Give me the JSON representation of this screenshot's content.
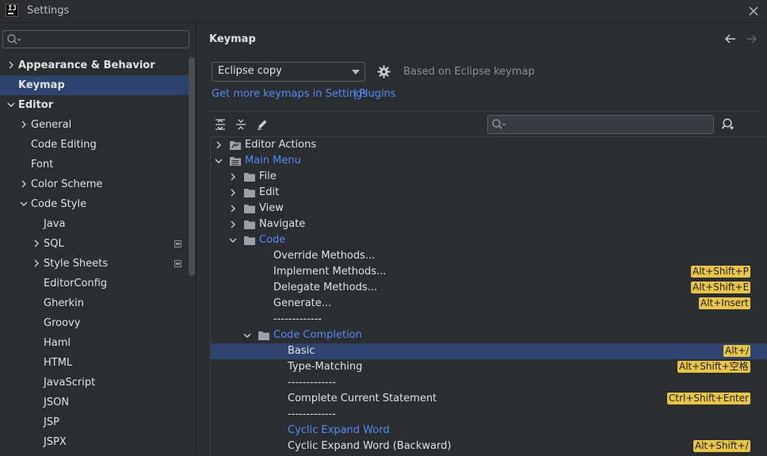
{
  "window": {
    "title": "Settings"
  },
  "sidebar": {
    "search_placeholder": "",
    "items": [
      {
        "label": "Appearance & Behavior",
        "arrow": "right",
        "bold": true
      },
      {
        "label": "Keymap",
        "arrow": "none",
        "bold": true,
        "selected": true
      },
      {
        "label": "Editor",
        "arrow": "down",
        "bold": true
      },
      {
        "label": "General",
        "arrow": "right"
      },
      {
        "label": "Code Editing",
        "arrow": "none"
      },
      {
        "label": "Font",
        "arrow": "none"
      },
      {
        "label": "Color Scheme",
        "arrow": "right"
      },
      {
        "label": "Code Style",
        "arrow": "down"
      },
      {
        "label": "Java",
        "arrow": "none"
      },
      {
        "label": "SQL",
        "arrow": "right",
        "project_icon": true
      },
      {
        "label": "Style Sheets",
        "arrow": "right",
        "project_icon": true
      },
      {
        "label": "EditorConfig",
        "arrow": "none"
      },
      {
        "label": "Gherkin",
        "arrow": "none"
      },
      {
        "label": "Groovy",
        "arrow": "none"
      },
      {
        "label": "Haml",
        "arrow": "none"
      },
      {
        "label": "HTML",
        "arrow": "none"
      },
      {
        "label": "JavaScript",
        "arrow": "none"
      },
      {
        "label": "JSON",
        "arrow": "none"
      },
      {
        "label": "JSP",
        "arrow": "none"
      },
      {
        "label": "JSPX",
        "arrow": "none"
      }
    ]
  },
  "main": {
    "title": "Keymap",
    "keymap_select": {
      "value": "Eclipse copy"
    },
    "based_on": "Based on Eclipse keymap",
    "link_keymaps": "Get more keymaps in Settings",
    "link_sep": "|",
    "link_plugins": "Plugins",
    "search_placeholder": ""
  },
  "tree": [
    {
      "label": "Editor Actions",
      "arrow": "right",
      "icon": "editor-actions-icon"
    },
    {
      "label": "Main Menu",
      "arrow": "down",
      "icon": "main-menu-icon",
      "blue": true
    },
    {
      "label": "File",
      "arrow": "right",
      "icon": "folder-icon"
    },
    {
      "label": "Edit",
      "arrow": "right",
      "icon": "folder-icon"
    },
    {
      "label": "View",
      "arrow": "right",
      "icon": "folder-icon"
    },
    {
      "label": "Navigate",
      "arrow": "right",
      "icon": "folder-icon"
    },
    {
      "label": "Code",
      "arrow": "down",
      "icon": "folder-icon",
      "blue": true
    },
    {
      "label": "Override Methods...",
      "arrow": "none"
    },
    {
      "label": "Implement Methods...",
      "arrow": "none",
      "shortcut": "Alt+Shift+P"
    },
    {
      "label": "Delegate Methods...",
      "arrow": "none",
      "shortcut": "Alt+Shift+E"
    },
    {
      "label": "Generate...",
      "arrow": "none",
      "shortcut": "Alt+Insert"
    },
    {
      "label": "-------------",
      "arrow": "none"
    },
    {
      "label": "Code Completion",
      "arrow": "down",
      "icon": "folder-icon",
      "blue": true
    },
    {
      "label": "Basic",
      "arrow": "none",
      "shortcut": "Alt+/",
      "selected": true
    },
    {
      "label": "Type-Matching",
      "arrow": "none",
      "shortcut": "Alt+Shift+空格"
    },
    {
      "label": "-------------",
      "arrow": "none"
    },
    {
      "label": "Complete Current Statement",
      "arrow": "none",
      "shortcut": "Ctrl+Shift+Enter"
    },
    {
      "label": "-------------",
      "arrow": "none"
    },
    {
      "label": "Cyclic Expand Word",
      "arrow": "none",
      "blue": true
    },
    {
      "label": "Cyclic Expand Word (Backward)",
      "arrow": "none",
      "shortcut": "Alt+Shift+/"
    }
  ],
  "colors": {
    "background": "#2b2d30",
    "selection": "#2e436e",
    "link": "#548af7",
    "shortcut_badge": "#e8c546"
  }
}
